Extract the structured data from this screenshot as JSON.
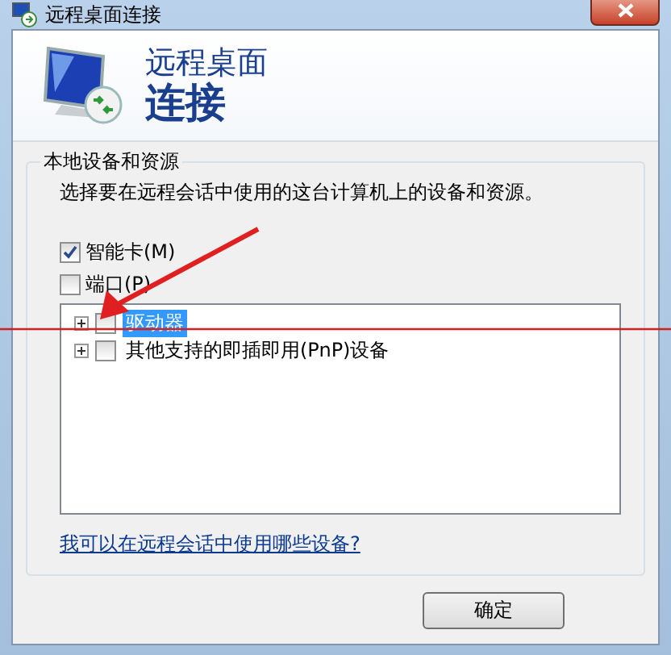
{
  "window": {
    "title": "远程桌面连接"
  },
  "header": {
    "line1": "远程桌面",
    "line2": "连接"
  },
  "group": {
    "title": "本地设备和资源",
    "description": "选择要在远程会话中使用的这台计算机上的设备和资源。",
    "options": [
      {
        "label": "智能卡(M)",
        "checked": true
      },
      {
        "label": "端口(P)",
        "checked": false
      }
    ],
    "tree": [
      {
        "label": "驱动器",
        "checked": false,
        "selected": true,
        "expanded": false
      },
      {
        "label": "其他支持的即插即用(PnP)设备",
        "checked": false,
        "selected": false,
        "expanded": false
      }
    ]
  },
  "link": "我可以在远程会话中使用哪些设备?",
  "buttons": [
    "确定"
  ]
}
